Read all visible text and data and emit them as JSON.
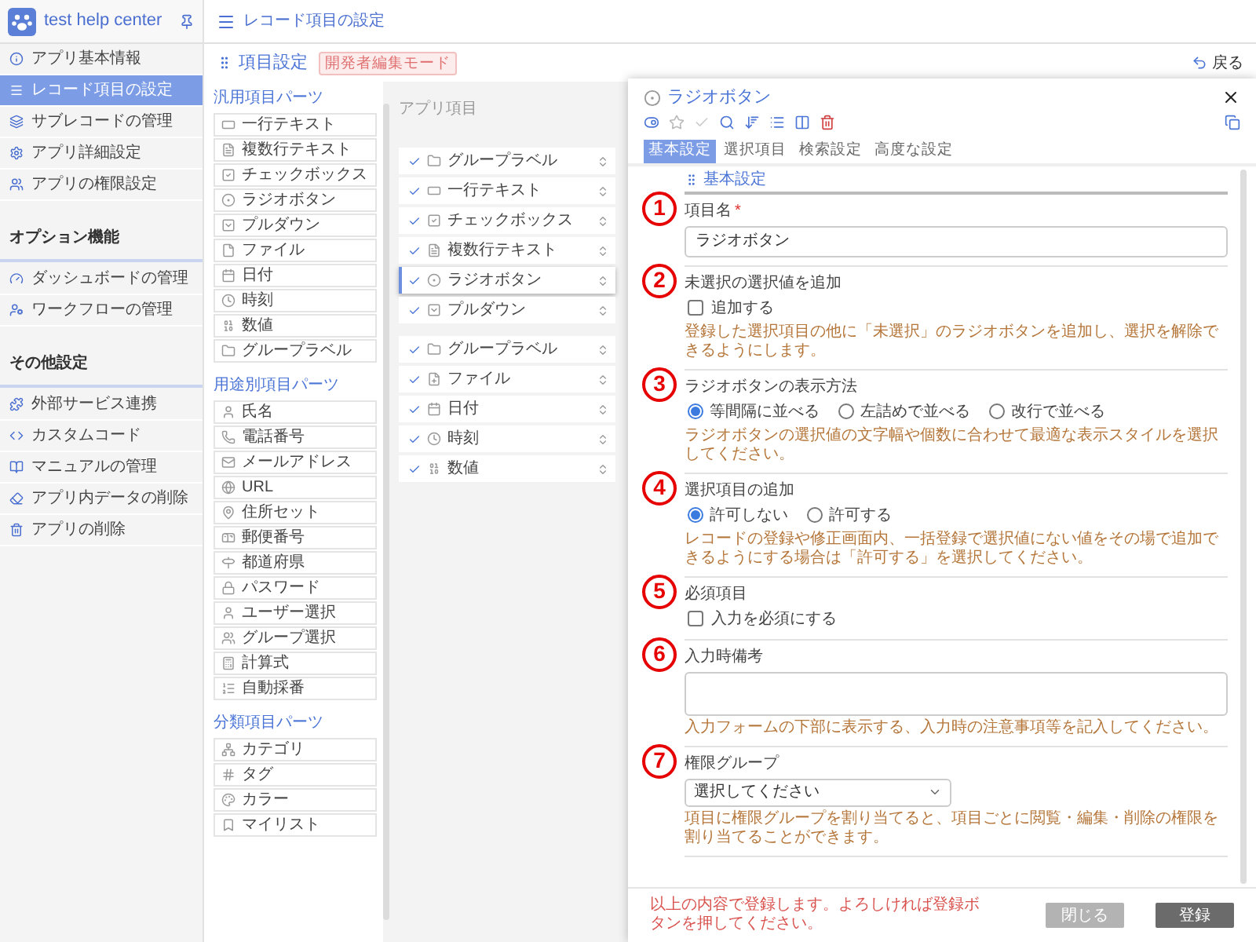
{
  "app": {
    "name": "test help center"
  },
  "header": {
    "title": "レコード項目の設定"
  },
  "sidebar": {
    "sections": [
      {
        "items": [
          {
            "label": "アプリ基本情報",
            "selected": false
          },
          {
            "label": "レコード項目の設定",
            "selected": true
          },
          {
            "label": "サブレコードの管理",
            "selected": false
          },
          {
            "label": "アプリ詳細設定",
            "selected": false
          },
          {
            "label": "アプリの権限設定",
            "selected": false
          }
        ]
      },
      {
        "heading": "オプション機能",
        "items": [
          {
            "label": "ダッシュボードの管理",
            "selected": false
          },
          {
            "label": "ワークフローの管理",
            "selected": false
          }
        ]
      },
      {
        "heading": "その他設定",
        "items": [
          {
            "label": "外部サービス連携",
            "selected": false
          },
          {
            "label": "カスタムコード",
            "selected": false
          },
          {
            "label": "マニュアルの管理",
            "selected": false
          },
          {
            "label": "アプリ内データの削除",
            "selected": false
          },
          {
            "label": "アプリの削除",
            "selected": false
          }
        ]
      }
    ]
  },
  "page": {
    "title": "項目設定",
    "badge": "開発者編集モード",
    "back": "戻る"
  },
  "parts": {
    "groups": [
      {
        "heading": "汎用項目パーツ",
        "items": [
          "一行テキスト",
          "複数行テキスト",
          "チェックボックス",
          "ラジオボタン",
          "プルダウン",
          "ファイル",
          "日付",
          "時刻",
          "数値",
          "グループラベル"
        ]
      },
      {
        "heading": "用途別項目パーツ",
        "items": [
          "氏名",
          "電話番号",
          "メールアドレス",
          "URL",
          "住所セット",
          "郵便番号",
          "都道府県",
          "パスワード",
          "ユーザー選択",
          "グループ選択",
          "計算式",
          "自動採番"
        ]
      },
      {
        "heading": "分類項目パーツ",
        "items": [
          "カテゴリ",
          "タグ",
          "カラー",
          "マイリスト"
        ]
      }
    ]
  },
  "app_items": {
    "heading": "アプリ項目",
    "groups": [
      [
        {
          "kind": "group",
          "label": "グループラベル",
          "checked": true,
          "selected": false
        },
        {
          "kind": "text",
          "label": "一行テキスト",
          "checked": true,
          "selected": false
        },
        {
          "kind": "checkbox",
          "label": "チェックボックス",
          "checked": true,
          "selected": false
        },
        {
          "kind": "multiline",
          "label": "複数行テキスト",
          "checked": true,
          "selected": false
        },
        {
          "kind": "radio",
          "label": "ラジオボタン",
          "checked": true,
          "selected": true
        },
        {
          "kind": "pulldown",
          "label": "プルダウン",
          "checked": true,
          "selected": false
        }
      ],
      [
        {
          "kind": "group",
          "label": "グループラベル",
          "checked": true,
          "selected": false
        },
        {
          "kind": "file",
          "label": "ファイル",
          "checked": true,
          "selected": false
        },
        {
          "kind": "date",
          "label": "日付",
          "checked": true,
          "selected": false
        },
        {
          "kind": "time",
          "label": "時刻",
          "checked": true,
          "selected": false
        },
        {
          "kind": "number",
          "label": "数値",
          "checked": true,
          "selected": false
        }
      ]
    ]
  },
  "panel": {
    "title": "ラジオボタン",
    "tabs": [
      {
        "label": "基本設定",
        "selected": true
      },
      {
        "label": "選択項目",
        "selected": false
      },
      {
        "label": "検索設定",
        "selected": false
      },
      {
        "label": "高度な設定",
        "selected": false
      }
    ],
    "section": "基本設定",
    "fields": [
      {
        "kind": "text",
        "marker": "1",
        "label": "項目名",
        "required_mark": "*",
        "value": "ラジオボタン"
      },
      {
        "kind": "checkbox",
        "marker": "2",
        "label": "未選択の選択値を追加",
        "option": "追加する",
        "checked": false,
        "help": "登録した選択項目の他に「未選択」のラジオボタンを追加し、選択を解除できるようにします。"
      },
      {
        "kind": "radio",
        "marker": "3",
        "label": "ラジオボタンの表示方法",
        "options": [
          {
            "label": "等間隔に並べる",
            "selected": true
          },
          {
            "label": "左詰めで並べる",
            "selected": false
          },
          {
            "label": "改行で並べる",
            "selected": false
          }
        ],
        "help": "ラジオボタンの選択値の文字幅や個数に合わせて最適な表示スタイルを選択してください。"
      },
      {
        "kind": "radio",
        "marker": "4",
        "label": "選択項目の追加",
        "options": [
          {
            "label": "許可しない",
            "selected": true
          },
          {
            "label": "許可する",
            "selected": false
          }
        ],
        "help": "レコードの登録や修正画面内、一括登録で選択値にない値をその場で追加できるようにする場合は「許可する」を選択してください。"
      },
      {
        "kind": "checkbox",
        "marker": "5",
        "label": "必須項目",
        "option": "入力を必須にする",
        "checked": false
      },
      {
        "kind": "textarea",
        "marker": "6",
        "label": "入力時備考",
        "help": "入力フォームの下部に表示する、入力時の注意事項等を記入してください。"
      },
      {
        "kind": "select",
        "marker": "7",
        "label": "権限グループ",
        "value": "選択してください",
        "help": "項目に権限グループを割り当てると、項目ごとに閲覧・編集・削除の権限を割り当てることができます。"
      }
    ],
    "footer_note": "以上の内容で登録します。よろしければ登録ボタンを押してください。",
    "buttons": [
      {
        "kind": "secondary",
        "label": "閉じる"
      },
      {
        "kind": "primary",
        "label": "登録"
      }
    ]
  }
}
